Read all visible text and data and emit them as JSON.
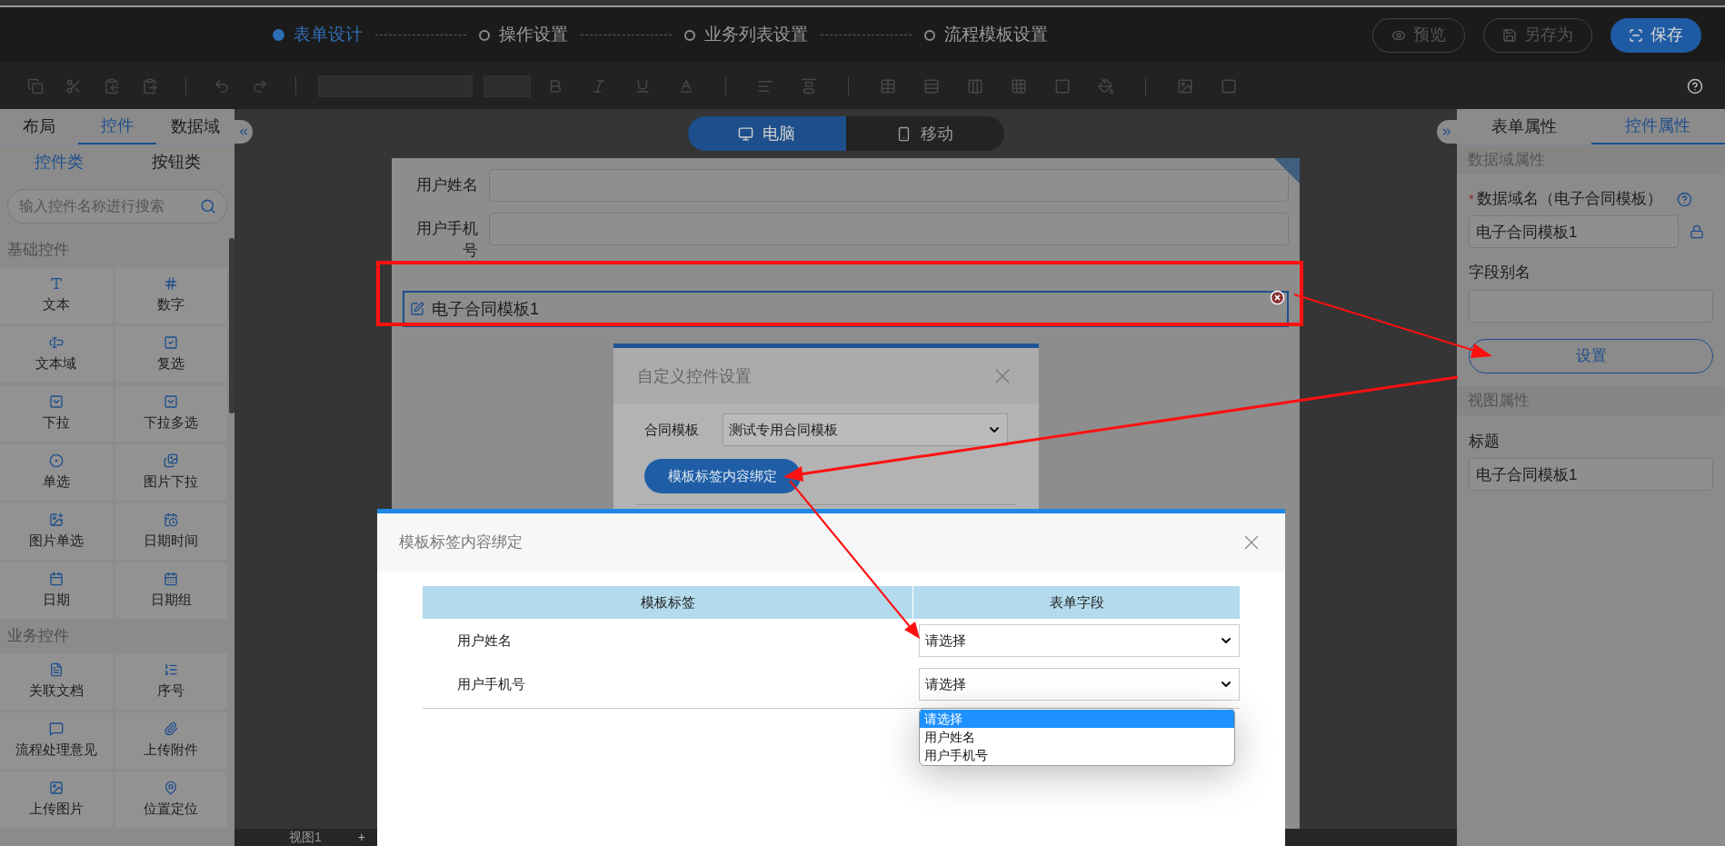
{
  "steps": [
    {
      "label": "表单设计",
      "selected": true
    },
    {
      "label": "操作设置",
      "selected": false
    },
    {
      "label": "业务列表设置",
      "selected": false
    },
    {
      "label": "流程模板设置",
      "selected": false
    }
  ],
  "header_buttons": [
    {
      "label": "预览",
      "kind": "outline"
    },
    {
      "label": "另存为",
      "kind": "outline"
    },
    {
      "label": "保存",
      "kind": "primary"
    }
  ],
  "left_panel": {
    "tabs": [
      {
        "label": "布局",
        "selected": false
      },
      {
        "label": "控件",
        "selected": true
      },
      {
        "label": "数据域",
        "selected": false
      }
    ],
    "subtabs": [
      {
        "label": "控件类",
        "selected": true
      },
      {
        "label": "按钮类",
        "selected": false
      }
    ],
    "search": {
      "placeholder": "输入控件名称进行搜索"
    },
    "groups": [
      {
        "title": "基础控件",
        "items": [
          "文本",
          "数字",
          "文本域",
          "复选",
          "下拉",
          "下拉多选",
          "单选",
          "图片下拉",
          "图片单选",
          "日期时间",
          "日期",
          "日期组"
        ]
      },
      {
        "title": "业务控件",
        "items": [
          "关联文档",
          "序号",
          "流程处理意见",
          "上传附件",
          "上传图片",
          "位置定位"
        ]
      }
    ]
  },
  "view_toggle": [
    {
      "label": "电脑",
      "selected": true
    },
    {
      "label": "移动",
      "selected": false
    }
  ],
  "form": {
    "fields": [
      {
        "label": "用户姓名"
      },
      {
        "label": "用户手机号"
      }
    ],
    "selected_control": {
      "label": "电子合同模板1"
    }
  },
  "right_panel": {
    "tabs": [
      {
        "label": "表单属性",
        "selected": false
      },
      {
        "label": "控件属性",
        "selected": true
      }
    ],
    "data_section": {
      "title": "数据域属性",
      "name_label": "数据域名（电子合同模板）",
      "required_mark": "*",
      "name_value": "电子合同模板1",
      "alias_label": "字段别名",
      "setting_button": "设置"
    },
    "view_section": {
      "title": "视图属性",
      "title_label": "标题",
      "title_value": "电子合同模板1"
    }
  },
  "custom_dialog": {
    "title": "自定义控件设置",
    "template_label": "合同模板",
    "template_value": "测试专用合同模板",
    "bind_button": "模板标签内容绑定"
  },
  "binding_dialog": {
    "title": "模板标签内容绑定",
    "columns": [
      "模板标签",
      "表单字段"
    ],
    "rows": [
      {
        "label": "用户姓名",
        "value": "请选择"
      },
      {
        "label": "用户手机号",
        "value": "请选择"
      }
    ],
    "open_dropdown": {
      "options": [
        {
          "label": "请选择",
          "selected": true
        },
        {
          "label": "用户姓名",
          "selected": false
        },
        {
          "label": "用户手机号",
          "selected": false
        }
      ]
    }
  },
  "bottom_bar": {
    "view_tabs": [
      "视图1"
    ],
    "add": "+"
  }
}
